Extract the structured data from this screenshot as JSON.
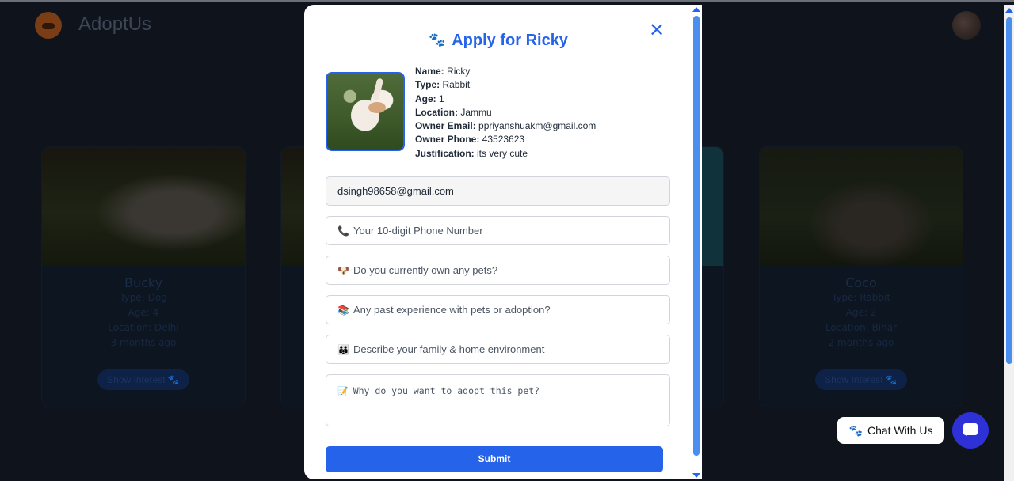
{
  "background": {
    "app_title": "AdoptUs",
    "cards": [
      {
        "name": "Bucky",
        "type": "Type: Dog",
        "age": "Age: 4",
        "location": "Location: Delhi",
        "posted": "3 months ago",
        "button": "Show Interest 🐾"
      },
      {
        "name": "Coco",
        "type": "Type: Rabbit",
        "age": "Age: 2",
        "location": "Location: Bihar",
        "posted": "2 months ago",
        "button": "Show Interest 🐾"
      }
    ]
  },
  "modal": {
    "title_icon": "🐾",
    "title": "Apply for Ricky",
    "close_symbol": "✕",
    "pet": {
      "name_label": "Name:",
      "name": "Ricky",
      "type_label": "Type:",
      "type": "Rabbit",
      "age_label": "Age:",
      "age": "1",
      "location_label": "Location:",
      "location": "Jammu",
      "email_label": "Owner Email:",
      "email": "ppriyanshuakm@gmail.com",
      "phone_label": "Owner Phone:",
      "phone": "43523623",
      "justification_label": "Justification:",
      "justification": "its very cute"
    },
    "form": {
      "email_value": "dsingh98658@gmail.com",
      "phone_icon": "📞",
      "phone_placeholder": "Your 10-digit Phone Number",
      "pets_icon": "🐶",
      "pets_placeholder": "Do you currently own any pets?",
      "experience_icon": "📚",
      "experience_placeholder": "Any past experience with pets or adoption?",
      "family_icon": "👪",
      "family_placeholder": "Describe your family & home environment",
      "reason_icon": "📝",
      "reason_placeholder": "Why do you want to adopt this pet?",
      "submit_label": "Submit"
    }
  },
  "chat": {
    "icon": "🐾",
    "label": "Chat With Us"
  },
  "colors": {
    "accent": "#2563eb",
    "chat_button": "#2d31d6"
  }
}
